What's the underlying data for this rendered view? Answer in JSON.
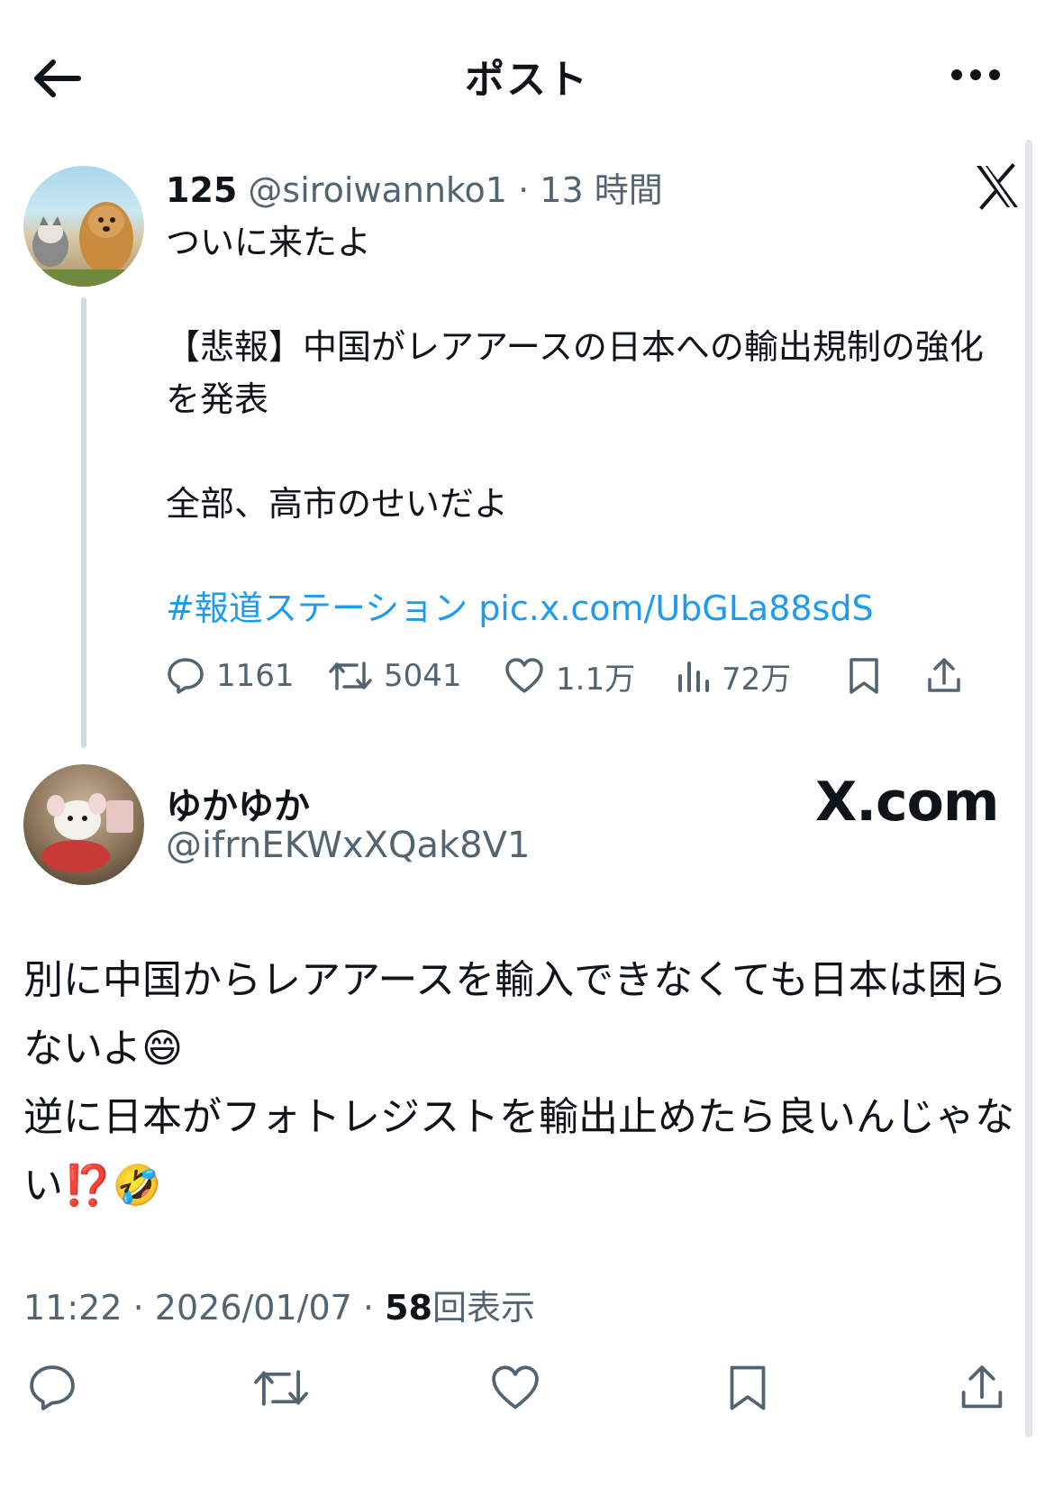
{
  "header": {
    "title": "ポスト"
  },
  "quoted_post": {
    "display_name": "125",
    "handle": "@siroiwannko1",
    "separator": "·",
    "time_ago": "13 時間",
    "text": "ついに来たよ\n\n【悲報】中国がレアアースの日本への輸出規制の強化を発表\n\n全部、高市のせいだよ",
    "hashtag": "#報道ステーション",
    "pic_link": "pic.x.com/UbGLa88sdS",
    "stats": {
      "replies": "1161",
      "reposts": "5041",
      "likes": "1.1万",
      "views": "72万"
    }
  },
  "reply": {
    "display_name": "ゆかゆか",
    "handle": "@ifrnEKWxXQak8V1",
    "watermark": "X.com",
    "text": "別に中国からレアアースを輸入できなくても日本は困らないよ😄\n逆に日本がフォトレジストを輸出止めたら良いんじゃない⁉️🤣",
    "time": "11:22",
    "date": "2026/01/07",
    "separator": "·",
    "view_count": "58",
    "view_label": "回表示"
  },
  "colors": {
    "text": "#0f1419",
    "muted": "#536471",
    "link": "#1d9bf0",
    "thread_line": "#cfd9de"
  },
  "icons": {
    "back": "arrow-left-icon",
    "more": "more-horizontal-icon",
    "x_logo": "x-logo-icon",
    "reply": "reply-icon",
    "repost": "repost-icon",
    "like": "heart-icon",
    "views": "analytics-icon",
    "bookmark": "bookmark-icon",
    "share": "share-icon"
  }
}
